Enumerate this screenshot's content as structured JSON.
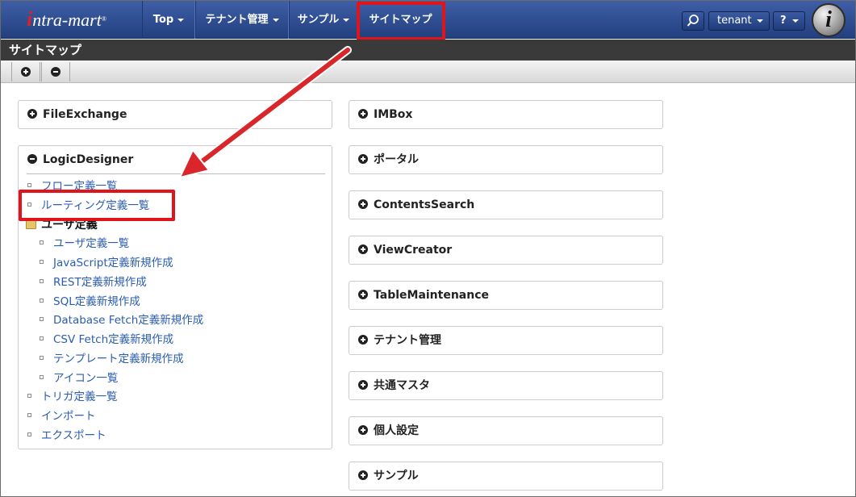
{
  "navbar": {
    "logo_mark": "i",
    "logo_text": "ntra-mart",
    "logo_reg": "®",
    "items": [
      {
        "label": "Top"
      },
      {
        "label": "テナント管理"
      },
      {
        "label": "サンプル"
      },
      {
        "label": "サイトマップ"
      }
    ],
    "tenant_label": "tenant",
    "help_label": "?",
    "avatar_glyph": "i"
  },
  "page": {
    "title": "サイトマップ"
  },
  "left": {
    "fileexchange": "FileExchange",
    "logicdesigner": "LogicDesigner",
    "items": [
      "フロー定義一覧",
      "ルーティング定義一覧"
    ],
    "user_folder": "ユーザ定義",
    "user_items": [
      "ユーザ定義一覧",
      "JavaScript定義新規作成",
      "REST定義新規作成",
      "SQL定義新規作成",
      "Database Fetch定義新規作成",
      "CSV Fetch定義新規作成",
      "テンプレート定義新規作成",
      "アイコン一覧"
    ],
    "bottom_items": [
      "トリガ定義一覧",
      "インポート",
      "エクスポート"
    ]
  },
  "right": {
    "panels": [
      "IMBox",
      "ポータル",
      "ContentsSearch",
      "ViewCreator",
      "TableMaintenance",
      "テナント管理",
      "共通マスタ",
      "個人設定",
      "サンプル"
    ]
  },
  "colors": {
    "navbar": "#2c4a8f",
    "highlight": "#e0141b",
    "link": "#2a5db0"
  }
}
